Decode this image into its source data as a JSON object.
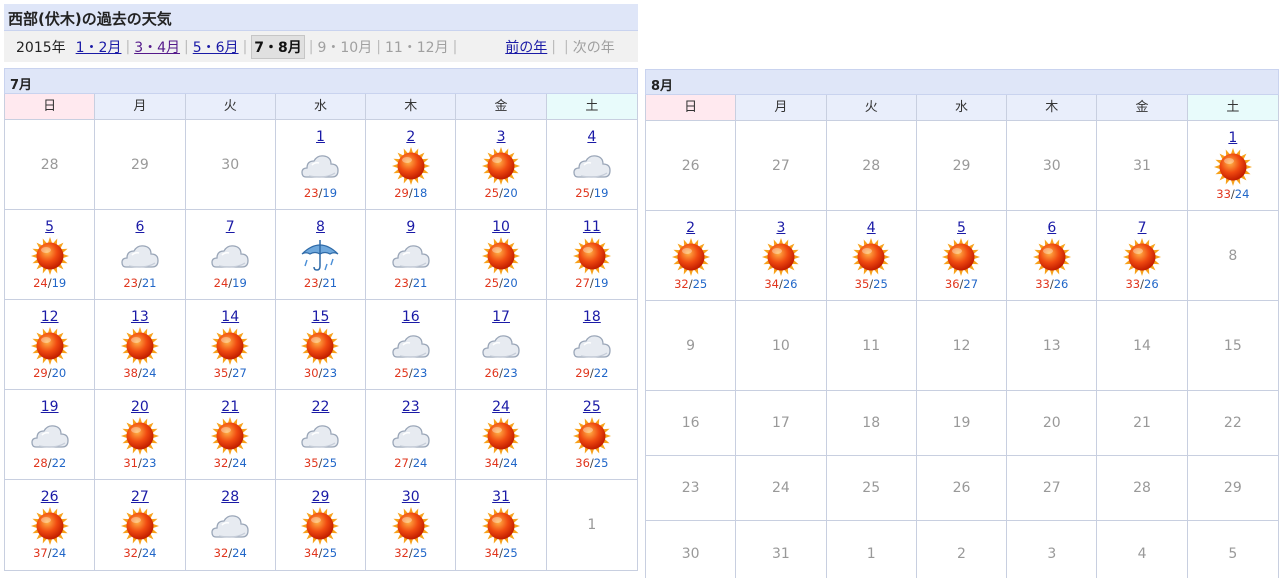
{
  "header": {
    "title": "西部(伏木)の過去の天気",
    "nav": [
      {
        "text": "2015年",
        "kind": "year"
      },
      {
        "text": "1・2月",
        "kind": "link"
      },
      {
        "text": "3・4月",
        "kind": "link-past"
      },
      {
        "text": "5・6月",
        "kind": "link"
      },
      {
        "text": "7・8月",
        "kind": "current"
      },
      {
        "text": "9・10月",
        "kind": "disabled"
      },
      {
        "text": "11・12月",
        "kind": "disabled"
      },
      {
        "text": "前の年",
        "kind": "link"
      },
      {
        "text": "次の年",
        "kind": "disabled"
      }
    ]
  },
  "weekdays": [
    "日",
    "月",
    "火",
    "水",
    "木",
    "金",
    "土"
  ],
  "icons": {
    "sunny": "sun-icon",
    "cloudy": "cloud-icon",
    "rain": "umbrella-icon"
  },
  "colors": {
    "high_temp": "#e0351c",
    "low_temp": "#2066c8",
    "link": "#1a1aa6",
    "muted": "#999999"
  },
  "months": [
    {
      "id": "month-7",
      "title": "7月",
      "weeks": [
        [
          {
            "day": "28",
            "muted": true
          },
          {
            "day": "29",
            "muted": true
          },
          {
            "day": "30",
            "muted": true
          },
          {
            "day": "1",
            "weather": "cloudy",
            "high": "23",
            "low": "19"
          },
          {
            "day": "2",
            "weather": "sunny",
            "high": "29",
            "low": "18"
          },
          {
            "day": "3",
            "weather": "sunny",
            "high": "25",
            "low": "20"
          },
          {
            "day": "4",
            "weather": "cloudy",
            "high": "25",
            "low": "19"
          }
        ],
        [
          {
            "day": "5",
            "weather": "sunny",
            "high": "24",
            "low": "19"
          },
          {
            "day": "6",
            "weather": "cloudy",
            "high": "23",
            "low": "21"
          },
          {
            "day": "7",
            "weather": "cloudy",
            "high": "24",
            "low": "19"
          },
          {
            "day": "8",
            "weather": "rain",
            "high": "23",
            "low": "21"
          },
          {
            "day": "9",
            "weather": "cloudy",
            "high": "23",
            "low": "21"
          },
          {
            "day": "10",
            "weather": "sunny",
            "high": "25",
            "low": "20"
          },
          {
            "day": "11",
            "weather": "sunny",
            "high": "27",
            "low": "19"
          }
        ],
        [
          {
            "day": "12",
            "weather": "sunny",
            "high": "29",
            "low": "20"
          },
          {
            "day": "13",
            "weather": "sunny",
            "high": "38",
            "low": "24"
          },
          {
            "day": "14",
            "weather": "sunny",
            "high": "35",
            "low": "27"
          },
          {
            "day": "15",
            "weather": "sunny",
            "high": "30",
            "low": "23"
          },
          {
            "day": "16",
            "weather": "cloudy",
            "high": "25",
            "low": "23"
          },
          {
            "day": "17",
            "weather": "cloudy",
            "high": "26",
            "low": "23"
          },
          {
            "day": "18",
            "weather": "cloudy",
            "high": "29",
            "low": "22"
          }
        ],
        [
          {
            "day": "19",
            "weather": "cloudy",
            "high": "28",
            "low": "22"
          },
          {
            "day": "20",
            "weather": "sunny",
            "high": "31",
            "low": "23"
          },
          {
            "day": "21",
            "weather": "sunny",
            "high": "32",
            "low": "24"
          },
          {
            "day": "22",
            "weather": "cloudy",
            "high": "35",
            "low": "25"
          },
          {
            "day": "23",
            "weather": "cloudy",
            "high": "27",
            "low": "24"
          },
          {
            "day": "24",
            "weather": "sunny",
            "high": "34",
            "low": "24"
          },
          {
            "day": "25",
            "weather": "sunny",
            "high": "36",
            "low": "25"
          }
        ],
        [
          {
            "day": "26",
            "weather": "sunny",
            "high": "37",
            "low": "24"
          },
          {
            "day": "27",
            "weather": "sunny",
            "high": "32",
            "low": "24"
          },
          {
            "day": "28",
            "weather": "cloudy",
            "high": "32",
            "low": "24"
          },
          {
            "day": "29",
            "weather": "sunny",
            "high": "34",
            "low": "25"
          },
          {
            "day": "30",
            "weather": "sunny",
            "high": "32",
            "low": "25"
          },
          {
            "day": "31",
            "weather": "sunny",
            "high": "34",
            "low": "25"
          },
          {
            "day": "1",
            "muted": true
          }
        ]
      ]
    },
    {
      "id": "month-8",
      "title": "8月",
      "weeks": [
        [
          {
            "day": "26",
            "muted": true
          },
          {
            "day": "27",
            "muted": true
          },
          {
            "day": "28",
            "muted": true
          },
          {
            "day": "29",
            "muted": true
          },
          {
            "day": "30",
            "muted": true
          },
          {
            "day": "31",
            "muted": true
          },
          {
            "day": "1",
            "weather": "sunny",
            "high": "33",
            "low": "24"
          }
        ],
        [
          {
            "day": "2",
            "weather": "sunny",
            "high": "32",
            "low": "25"
          },
          {
            "day": "3",
            "weather": "sunny",
            "high": "34",
            "low": "26"
          },
          {
            "day": "4",
            "weather": "sunny",
            "high": "35",
            "low": "25"
          },
          {
            "day": "5",
            "weather": "sunny",
            "high": "36",
            "low": "27"
          },
          {
            "day": "6",
            "weather": "sunny",
            "high": "33",
            "low": "26"
          },
          {
            "day": "7",
            "weather": "sunny",
            "high": "33",
            "low": "26"
          },
          {
            "day": "8",
            "muted": true
          }
        ],
        [
          {
            "day": "9",
            "muted": true
          },
          {
            "day": "10",
            "muted": true
          },
          {
            "day": "11",
            "muted": true
          },
          {
            "day": "12",
            "muted": true
          },
          {
            "day": "13",
            "muted": true
          },
          {
            "day": "14",
            "muted": true
          },
          {
            "day": "15",
            "muted": true
          }
        ],
        [
          {
            "day": "16",
            "muted": true
          },
          {
            "day": "17",
            "muted": true
          },
          {
            "day": "18",
            "muted": true
          },
          {
            "day": "19",
            "muted": true
          },
          {
            "day": "20",
            "muted": true
          },
          {
            "day": "21",
            "muted": true
          },
          {
            "day": "22",
            "muted": true
          }
        ],
        [
          {
            "day": "23",
            "muted": true
          },
          {
            "day": "24",
            "muted": true
          },
          {
            "day": "25",
            "muted": true
          },
          {
            "day": "26",
            "muted": true
          },
          {
            "day": "27",
            "muted": true
          },
          {
            "day": "28",
            "muted": true
          },
          {
            "day": "29",
            "muted": true
          }
        ],
        [
          {
            "day": "30",
            "muted": true
          },
          {
            "day": "31",
            "muted": true
          },
          {
            "day": "1",
            "muted": true
          },
          {
            "day": "2",
            "muted": true
          },
          {
            "day": "3",
            "muted": true
          },
          {
            "day": "4",
            "muted": true
          },
          {
            "day": "5",
            "muted": true
          }
        ]
      ]
    }
  ]
}
